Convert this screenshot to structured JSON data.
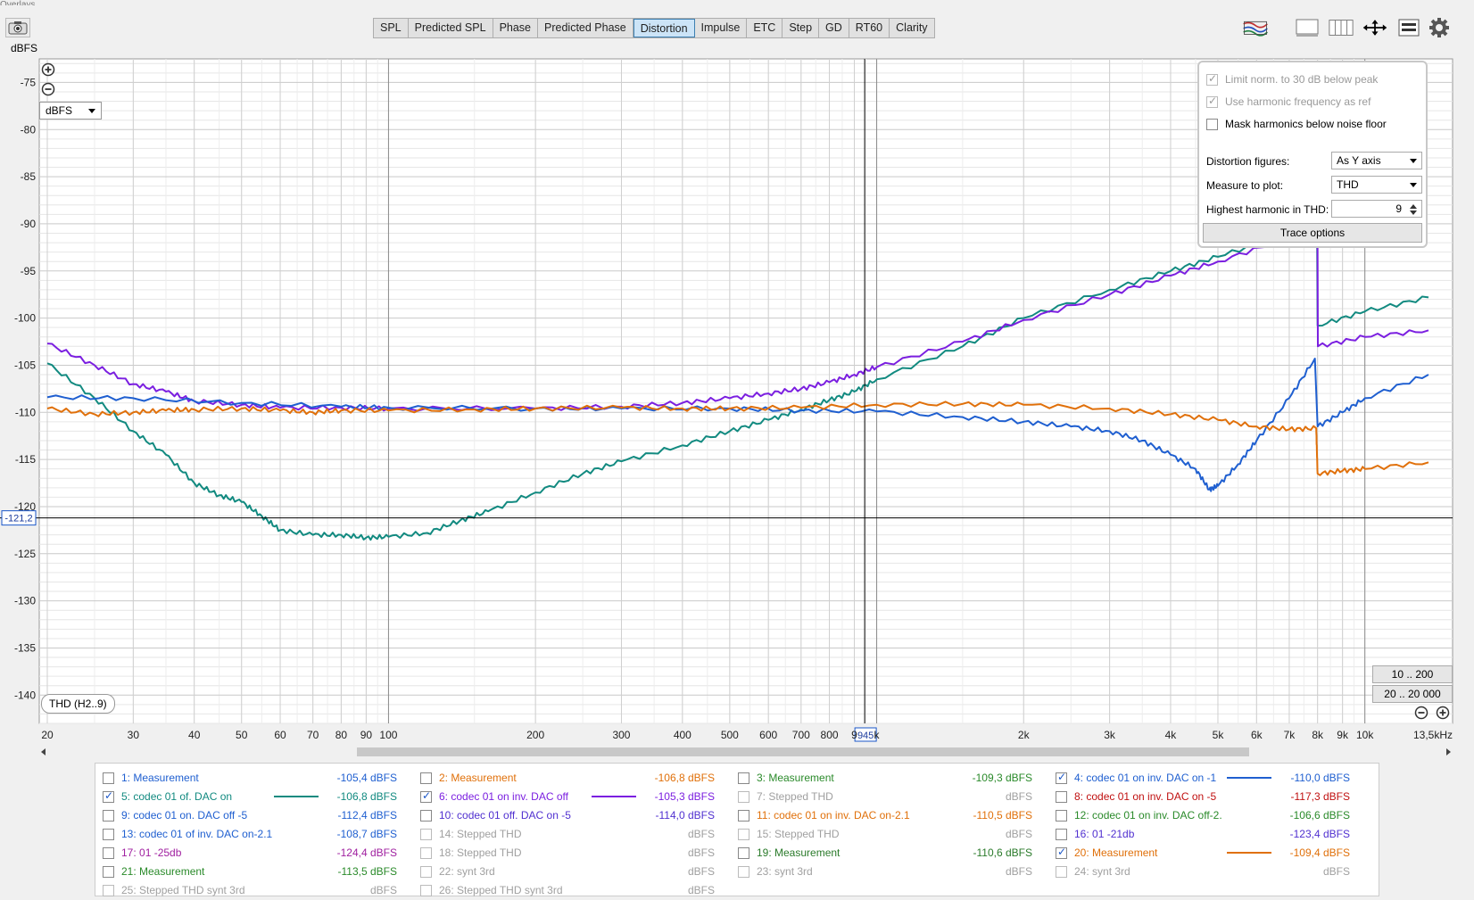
{
  "window": {
    "title": "Overlays"
  },
  "tabs": [
    {
      "label": "SPL",
      "active": false
    },
    {
      "label": "Predicted SPL",
      "active": false
    },
    {
      "label": "Phase",
      "active": false
    },
    {
      "label": "Predicted Phase",
      "active": false
    },
    {
      "label": "Distortion",
      "active": true
    },
    {
      "label": "Impulse",
      "active": false
    },
    {
      "label": "ETC",
      "active": false
    },
    {
      "label": "Step",
      "active": false
    },
    {
      "label": "GD",
      "active": false
    },
    {
      "label": "RT60",
      "active": false
    },
    {
      "label": "Clarity",
      "active": false
    }
  ],
  "toolbar_icons": [
    "traces-icon",
    "single-pane-icon",
    "multi-pane-icon",
    "move-icon",
    "list-icon",
    "gear-icon"
  ],
  "y_unit_label": "dBFS",
  "unit_select": {
    "value": "dBFS"
  },
  "measure_badge": "THD (H2..9)",
  "cursor": {
    "y_readout": "-121,2",
    "x_readout": "945"
  },
  "range_buttons": [
    "10 .. 200",
    "20 .. 20 000"
  ],
  "options_panel": {
    "limit_norm": {
      "label": "Limit norm. to 30 dB below peak",
      "checked": true,
      "enabled": false
    },
    "use_harmonic": {
      "label": "Use harmonic frequency as ref",
      "checked": true,
      "enabled": false
    },
    "mask_harmonics": {
      "label": "Mask harmonics below noise floor",
      "checked": false,
      "enabled": true
    },
    "distortion_figures_label": "Distortion figures:",
    "distortion_figures_value": "As Y axis",
    "measure_to_plot_label": "Measure to plot:",
    "measure_to_plot_value": "THD",
    "highest_harmonic_label": "Highest harmonic in THD:",
    "highest_harmonic_value": "9",
    "trace_options_label": "Trace options"
  },
  "legend": [
    {
      "label": "1: Measurement",
      "value": "-105,4 dBFS",
      "checked": false,
      "color": "#1f5fd0",
      "enabled": true
    },
    {
      "label": "2: Measurement",
      "value": "-106,8 dBFS",
      "checked": false,
      "color": "#e0700a",
      "enabled": true
    },
    {
      "label": "3: Measurement",
      "value": "-109,3 dBFS",
      "checked": false,
      "color": "#2a8a2a",
      "enabled": true
    },
    {
      "label": "4: codec 01 on inv. DAC on -1",
      "value": "-110,0 dBFS",
      "checked": true,
      "color": "#1f5fd0",
      "enabled": true
    },
    {
      "label": "5: codec 01 of. DAC on",
      "value": "-106,8 dBFS",
      "checked": true,
      "color": "#128a80",
      "enabled": true
    },
    {
      "label": "6: codec 01 on inv. DAC off",
      "value": "-105,3 dBFS",
      "checked": true,
      "color": "#7b1fe0",
      "enabled": true
    },
    {
      "label": "7: Stepped THD",
      "value": "dBFS",
      "checked": false,
      "color": "#a0a0a0",
      "enabled": false
    },
    {
      "label": "8: codec 01 on inv. DAC on -5",
      "value": "-117,3 dBFS",
      "checked": false,
      "color": "#c01010",
      "enabled": true
    },
    {
      "label": "9: codec 01 on. DAC off -5",
      "value": "-112,4 dBFS",
      "checked": false,
      "color": "#1f5fd0",
      "enabled": true
    },
    {
      "label": "10: codec 01 off. DAC on -5",
      "value": "-114,0 dBFS",
      "checked": false,
      "color": "#5030d0",
      "enabled": true
    },
    {
      "label": "11: codec 01 on inv. DAC on-2.1",
      "value": "-110,5 dBFS",
      "checked": false,
      "color": "#e0700a",
      "enabled": true
    },
    {
      "label": "12: codec 01 on inv. DAC off-2.",
      "value": "-106,6 dBFS",
      "checked": false,
      "color": "#2a8a2a",
      "enabled": true
    },
    {
      "label": "13: codec 01 of inv. DAC on-2.1",
      "value": "-108,7 dBFS",
      "checked": false,
      "color": "#1f5fd0",
      "enabled": true
    },
    {
      "label": "14: Stepped THD",
      "value": "dBFS",
      "checked": false,
      "color": "#a0a0a0",
      "enabled": false
    },
    {
      "label": "15: Stepped THD",
      "value": "dBFS",
      "checked": false,
      "color": "#a0a0a0",
      "enabled": false
    },
    {
      "label": "16: 01 -21db",
      "value": "-123,4 dBFS",
      "checked": false,
      "color": "#5030d0",
      "enabled": true
    },
    {
      "label": "17: 01 -25db",
      "value": "-124,4 dBFS",
      "checked": false,
      "color": "#a020a0",
      "enabled": true
    },
    {
      "label": "18: Stepped THD",
      "value": "dBFS",
      "checked": false,
      "color": "#a0a0a0",
      "enabled": false
    },
    {
      "label": "19: Measurement",
      "value": "-110,6 dBFS",
      "checked": false,
      "color": "#2a7a2a",
      "enabled": true
    },
    {
      "label": "20: Measurement",
      "value": "-109,4 dBFS",
      "checked": true,
      "color": "#e0700a",
      "enabled": true
    },
    {
      "label": "21: Measurement",
      "value": "-113,5 dBFS",
      "checked": false,
      "color": "#2a8a2a",
      "enabled": true
    },
    {
      "label": "22: synt 3rd",
      "value": "dBFS",
      "checked": false,
      "color": "#a0a0a0",
      "enabled": false
    },
    {
      "label": "23: synt 3rd",
      "value": "dBFS",
      "checked": false,
      "color": "#a0a0a0",
      "enabled": false
    },
    {
      "label": "24: synt 3rd",
      "value": "dBFS",
      "checked": false,
      "color": "#a0a0a0",
      "enabled": false
    },
    {
      "label": "25: Stepped THD synt 3rd",
      "value": "dBFS",
      "checked": false,
      "color": "#a0a0a0",
      "enabled": false
    },
    {
      "label": "26: Stepped THD synt 3rd",
      "value": "dBFS",
      "checked": false,
      "color": "#a0a0a0",
      "enabled": false
    }
  ],
  "chart_data": {
    "type": "line",
    "ylabel": "dBFS",
    "xscale": "log",
    "xlim": [
      20,
      13500
    ],
    "ylim": [
      -143,
      -72.5
    ],
    "x_ticks": [
      {
        "v": 20,
        "t": "20"
      },
      {
        "v": 30,
        "t": "30"
      },
      {
        "v": 40,
        "t": "40"
      },
      {
        "v": 50,
        "t": "50"
      },
      {
        "v": 60,
        "t": "60"
      },
      {
        "v": 70,
        "t": "70"
      },
      {
        "v": 80,
        "t": "80"
      },
      {
        "v": 90,
        "t": "90"
      },
      {
        "v": 100,
        "t": "100"
      },
      {
        "v": 200,
        "t": "200"
      },
      {
        "v": 300,
        "t": "300"
      },
      {
        "v": 400,
        "t": "400"
      },
      {
        "v": 500,
        "t": "500"
      },
      {
        "v": 600,
        "t": "600"
      },
      {
        "v": 700,
        "t": "700"
      },
      {
        "v": 800,
        "t": "800"
      },
      {
        "v": 900,
        "t": "9"
      },
      {
        "v": 1000,
        "t": "k"
      },
      {
        "v": 2000,
        "t": "2k"
      },
      {
        "v": 3000,
        "t": "3k"
      },
      {
        "v": 4000,
        "t": "4k"
      },
      {
        "v": 5000,
        "t": "5k"
      },
      {
        "v": 6000,
        "t": "6k"
      },
      {
        "v": 7000,
        "t": "7k"
      },
      {
        "v": 8000,
        "t": "8k"
      },
      {
        "v": 9000,
        "t": "9k"
      },
      {
        "v": 10000,
        "t": "10k"
      },
      {
        "v": 13500,
        "t": "13,5kHz"
      }
    ],
    "y_ticks": [
      -75,
      -80,
      -85,
      -90,
      -95,
      -100,
      -105,
      -110,
      -115,
      -120,
      -125,
      -130,
      -135,
      -140
    ],
    "grid": true,
    "cursor_x": 945,
    "cursor_y": -121.2,
    "series": [
      {
        "name": "5: codec 01 of. DAC on",
        "color": "#128a80",
        "points": [
          [
            20,
            -104.8
          ],
          [
            25,
            -108.5
          ],
          [
            30,
            -112
          ],
          [
            35,
            -114.5
          ],
          [
            40,
            -117.5
          ],
          [
            45,
            -118.8
          ],
          [
            50,
            -119.5
          ],
          [
            55,
            -121
          ],
          [
            60,
            -122.5
          ],
          [
            70,
            -123
          ],
          [
            80,
            -123
          ],
          [
            90,
            -123.3
          ],
          [
            100,
            -123.2
          ],
          [
            120,
            -122.8
          ],
          [
            140,
            -121.5
          ],
          [
            160,
            -120.5
          ],
          [
            200,
            -118.5
          ],
          [
            250,
            -116.5
          ],
          [
            300,
            -115.2
          ],
          [
            400,
            -113.5
          ],
          [
            500,
            -112
          ],
          [
            600,
            -110.8
          ],
          [
            700,
            -109.7
          ],
          [
            800,
            -108.7
          ],
          [
            900,
            -107.8
          ],
          [
            1000,
            -106.5
          ],
          [
            1500,
            -103
          ],
          [
            2000,
            -100
          ],
          [
            3000,
            -97
          ],
          [
            4000,
            -95
          ],
          [
            5000,
            -93.5
          ],
          [
            7000,
            -91
          ],
          [
            7950,
            -90
          ],
          [
            7980,
            -90
          ],
          [
            8000,
            -100.8
          ],
          [
            10000,
            -99.3
          ],
          [
            13500,
            -97.8
          ]
        ]
      },
      {
        "name": "6: codec 01 on inv. DAC off",
        "color": "#7b1fe0",
        "points": [
          [
            20,
            -102.7
          ],
          [
            25,
            -105
          ],
          [
            30,
            -107
          ],
          [
            35,
            -107.8
          ],
          [
            40,
            -108.8
          ],
          [
            50,
            -109.2
          ],
          [
            60,
            -109.5
          ],
          [
            80,
            -109.5
          ],
          [
            100,
            -109.6
          ],
          [
            200,
            -109.6
          ],
          [
            300,
            -109.4
          ],
          [
            400,
            -109
          ],
          [
            500,
            -108.5
          ],
          [
            600,
            -108
          ],
          [
            700,
            -107.5
          ],
          [
            800,
            -106.8
          ],
          [
            900,
            -106
          ],
          [
            1000,
            -105.2
          ],
          [
            1500,
            -102.5
          ],
          [
            2000,
            -100.2
          ],
          [
            3000,
            -97.5
          ],
          [
            4000,
            -95.5
          ],
          [
            5000,
            -94
          ],
          [
            7000,
            -91.5
          ],
          [
            7950,
            -90.3
          ],
          [
            7980,
            -74.5
          ],
          [
            8010,
            -103
          ],
          [
            10000,
            -102
          ],
          [
            13500,
            -101.3
          ]
        ]
      },
      {
        "name": "4: codec 01 on inv. DAC on -1",
        "color": "#1f5fd0",
        "points": [
          [
            20,
            -108.4
          ],
          [
            30,
            -108.5
          ],
          [
            50,
            -109
          ],
          [
            80,
            -109.4
          ],
          [
            100,
            -109.5
          ],
          [
            200,
            -109.6
          ],
          [
            300,
            -109.6
          ],
          [
            500,
            -109.6
          ],
          [
            700,
            -109.8
          ],
          [
            1000,
            -109.9
          ],
          [
            1500,
            -110.5
          ],
          [
            2000,
            -111
          ],
          [
            2500,
            -111.5
          ],
          [
            3000,
            -112
          ],
          [
            3500,
            -113
          ],
          [
            4000,
            -114.5
          ],
          [
            4500,
            -116
          ],
          [
            4800,
            -118.2
          ],
          [
            5000,
            -117.8
          ],
          [
            5500,
            -115.5
          ],
          [
            6000,
            -113
          ],
          [
            7000,
            -108.5
          ],
          [
            7900,
            -104.3
          ],
          [
            8000,
            -111.5
          ],
          [
            9000,
            -110
          ],
          [
            10000,
            -108.5
          ],
          [
            13500,
            -106
          ]
        ]
      },
      {
        "name": "20: Measurement",
        "color": "#e0700a",
        "points": [
          [
            20,
            -109.6
          ],
          [
            25,
            -110.2
          ],
          [
            30,
            -110
          ],
          [
            35,
            -109.8
          ],
          [
            40,
            -109.7
          ],
          [
            50,
            -109.6
          ],
          [
            60,
            -109.8
          ],
          [
            70,
            -110
          ],
          [
            80,
            -109.8
          ],
          [
            100,
            -109.8
          ],
          [
            150,
            -109.7
          ],
          [
            200,
            -109.6
          ],
          [
            300,
            -109.5
          ],
          [
            400,
            -109.6
          ],
          [
            500,
            -109.6
          ],
          [
            700,
            -109.5
          ],
          [
            1000,
            -109.2
          ],
          [
            1500,
            -109.1
          ],
          [
            2000,
            -109.2
          ],
          [
            3000,
            -109.6
          ],
          [
            4000,
            -110.2
          ],
          [
            5000,
            -110.8
          ],
          [
            6000,
            -111.5
          ],
          [
            7000,
            -111.8
          ],
          [
            7950,
            -111.7
          ],
          [
            8000,
            -116.5
          ],
          [
            9000,
            -116.2
          ],
          [
            10000,
            -116
          ],
          [
            13500,
            -115.3
          ]
        ]
      }
    ]
  }
}
